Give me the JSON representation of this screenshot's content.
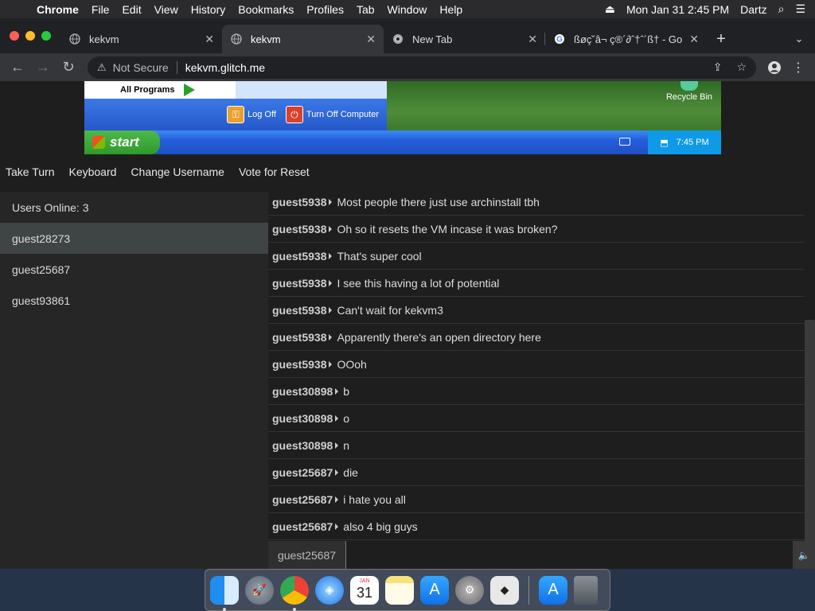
{
  "menubar": {
    "app": "Chrome",
    "items": [
      "File",
      "Edit",
      "View",
      "History",
      "Bookmarks",
      "Profiles",
      "Tab",
      "Window",
      "Help"
    ],
    "datetime": "Mon Jan 31  2:45 PM",
    "user": "Dartz"
  },
  "tabs": [
    {
      "title": "kekvm",
      "icon": "globe-icon"
    },
    {
      "title": "kekvm",
      "icon": "globe-icon"
    },
    {
      "title": "New Tab",
      "icon": "chrome-icon"
    },
    {
      "title": "ßøç˘â¬ ç®´∂ˆ†ˆ´ß† - Go",
      "icon": "google-icon"
    }
  ],
  "toolbar": {
    "security_label": "Not Secure",
    "url": "kekvm.glitch.me"
  },
  "vm": {
    "all_programs": "All Programs",
    "log_off": "Log Off",
    "turn_off": "Turn Off Computer",
    "start": "start",
    "clock": "7:45 PM",
    "recycle_bin": "Recycle Bin"
  },
  "controls": {
    "take_turn": "Take Turn",
    "keyboard": "Keyboard",
    "change_username": "Change Username",
    "vote_reset": "Vote for Reset"
  },
  "users": {
    "online_label": "Users Online: 3",
    "list": [
      "guest28273",
      "guest25687",
      "guest93861"
    ]
  },
  "chat": {
    "messages": [
      {
        "user": "guest5938",
        "text": "Most people there just use archinstall tbh"
      },
      {
        "user": "guest5938",
        "text": "Oh so it resets the VM incase it was broken?"
      },
      {
        "user": "guest5938",
        "text": "That's super cool"
      },
      {
        "user": "guest5938",
        "text": "I see this having a lot of potential"
      },
      {
        "user": "guest5938",
        "text": "Can't wait for kekvm3"
      },
      {
        "user": "guest5938",
        "text": "Apparently there's an open directory here"
      },
      {
        "user": "guest5938",
        "text": "OOoh"
      },
      {
        "user": "guest30898",
        "text": "b"
      },
      {
        "user": "guest30898",
        "text": "o"
      },
      {
        "user": "guest30898",
        "text": "n"
      },
      {
        "user": "guest25687",
        "text": "die"
      },
      {
        "user": "guest25687",
        "text": "i hate you all"
      },
      {
        "user": "guest25687",
        "text": "also 4 big guys"
      }
    ],
    "current_user": "guest25687",
    "input_value": ""
  },
  "dock": {
    "calendar_month": "JAN",
    "calendar_day": "31"
  }
}
